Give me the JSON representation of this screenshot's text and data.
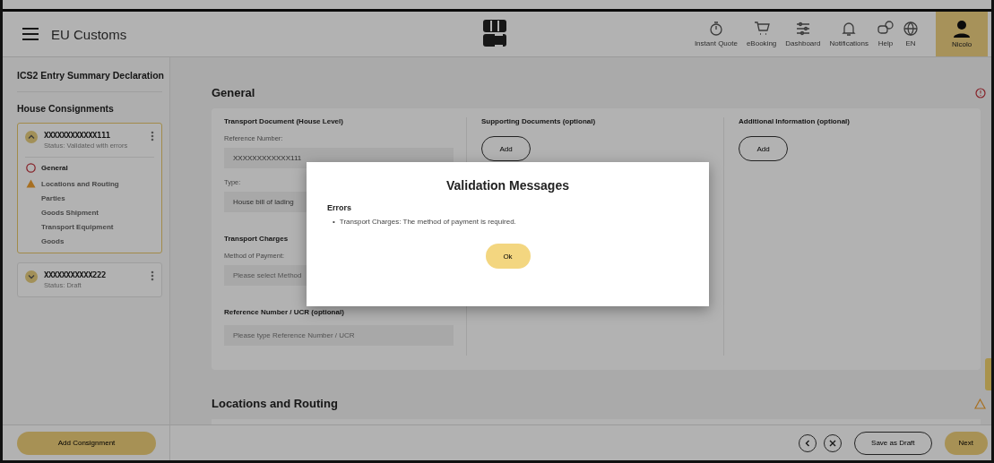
{
  "header": {
    "title": "EU Customs",
    "nav": [
      {
        "label": "Instant Quote"
      },
      {
        "label": "eBooking"
      },
      {
        "label": "Dashboard"
      },
      {
        "label": "Notifications"
      },
      {
        "label": "Help"
      },
      {
        "label": "EN"
      }
    ],
    "user": {
      "label": "Nicolo"
    }
  },
  "sidebar": {
    "title": "ICS2 Entry Summary Declaration",
    "section": "House Consignments",
    "consignments": [
      {
        "id": "XXXXXXXXXXXX111",
        "status": "Status: Validated with errors",
        "expanded": true,
        "selected": true,
        "steps": [
          {
            "label": "General",
            "kind": "error"
          },
          {
            "label": "Locations and Routing",
            "kind": "warning"
          },
          {
            "label": "Parties",
            "kind": "plain"
          },
          {
            "label": "Goods Shipment",
            "kind": "plain"
          },
          {
            "label": "Transport Equipment",
            "kind": "plain"
          },
          {
            "label": "Goods",
            "kind": "plain"
          }
        ]
      },
      {
        "id": "XXXXXXXXXXX222",
        "status": "Status: Draft",
        "expanded": false,
        "selected": false
      }
    ],
    "add_button": "Add Consignment"
  },
  "main": {
    "sections": [
      {
        "title": "General",
        "kind": "error"
      },
      {
        "title": "Locations and Routing",
        "kind": "warning"
      }
    ],
    "transport_document": {
      "title": "Transport Document (House Level)",
      "reference_label": "Reference Number:",
      "reference_value": "XXXXXXXXXXXX111",
      "type_label": "Type:",
      "type_value": "House bill of lading"
    },
    "transport_charges": {
      "title": "Transport Charges",
      "method_label": "Method of Payment:",
      "method_placeholder": "Please select Method"
    },
    "ucr": {
      "title": "Reference Number / UCR (optional)",
      "placeholder": "Please type Reference Number / UCR"
    },
    "supporting_documents": {
      "title": "Supporting Documents (optional)",
      "button": "Add"
    },
    "additional_information": {
      "title": "Additional Information (optional)",
      "button": "Add"
    }
  },
  "footer": {
    "save_button": "Save as Draft",
    "next_button": "Next"
  },
  "dialog": {
    "title": "Validation Messages",
    "section": "Errors",
    "messages": [
      {
        "bullet": "•",
        "text": "Transport Charges: The method of payment is required."
      }
    ],
    "button": "Ok"
  }
}
